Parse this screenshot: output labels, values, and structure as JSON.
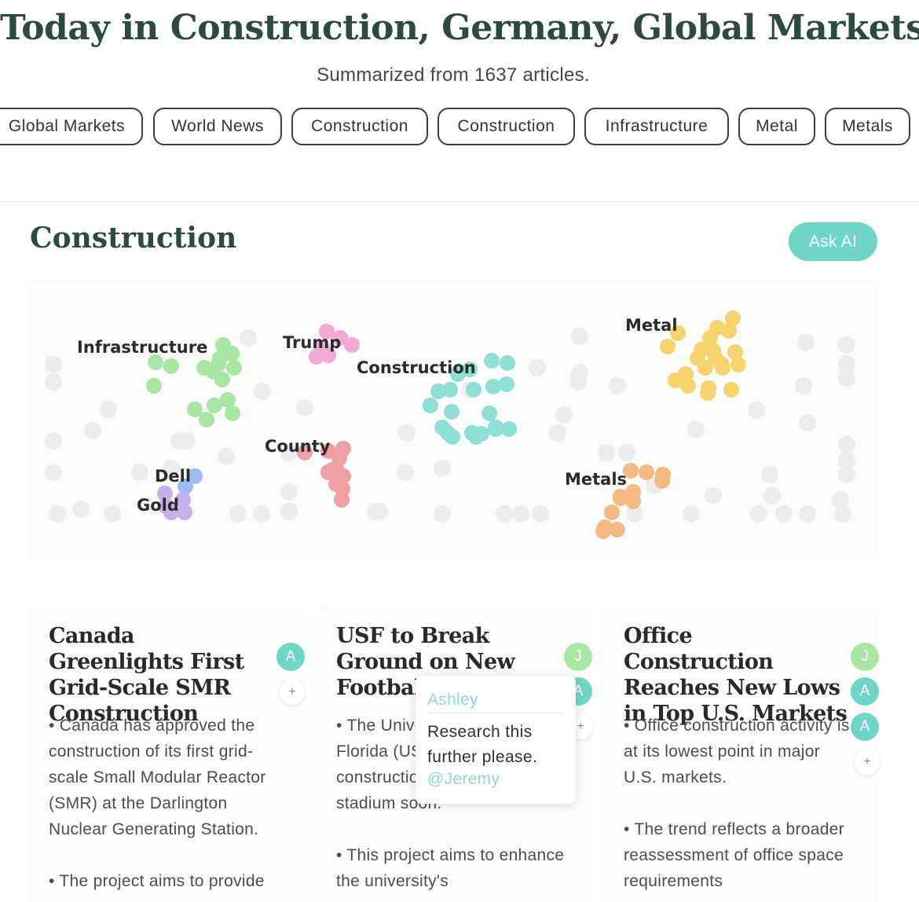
{
  "page": {
    "title": "Today in Construction, Germany, Global Markets",
    "subtitle": "Summarized from 1637 articles."
  },
  "tags": [
    "Global Markets",
    "World News",
    "Construction",
    "Construction",
    "Infrastructure",
    "Metal",
    "Metals"
  ],
  "section": {
    "title": "Construction",
    "ask_ai_label": "Ask AI"
  },
  "cluster_map": {
    "labels": [
      "Infrastructure",
      "Trump",
      "Construction",
      "Metal",
      "County",
      "Dell",
      "Gold",
      "Metals"
    ],
    "colors": {
      "Infrastructure": "#a8e6a3",
      "Trump": "#f2a9d4",
      "Construction": "#8fe0d4",
      "Metal": "#f7d36e",
      "County": "#f0a0a0",
      "Dell": "#9dbdf0",
      "Gold": "#c5b0ec",
      "Metals": "#f5b982",
      "other": "#ececec"
    }
  },
  "cards": [
    {
      "title": "Canada Greenlights First Grid-Scale SMR Construction",
      "bullets": [
        "• Canada has approved the construction of its first grid-scale Small Modular Reactor (SMR) at the Darlington Nuclear Generating Station.",
        "• The project aims to provide"
      ],
      "avatars": [
        "A"
      ],
      "add_label": "+"
    },
    {
      "title": "USF to Break Ground on New Football Stadium",
      "bullets": [
        "• The University of South Florida (USF) will be starting construction on a new football stadium soon.",
        "• This project aims to enhance the university's"
      ],
      "avatars": [
        "J",
        "A"
      ],
      "add_label": "+"
    },
    {
      "title": "Office Construction Reaches New Lows in Top U.S. Markets",
      "bullets": [
        "• Office construction activity is at its lowest point in major U.S. markets.",
        "• The trend reflects a broader reassessment of office space requirements"
      ],
      "avatars": [
        "J",
        "A",
        "A"
      ],
      "add_label": "+"
    }
  ],
  "comment_popup": {
    "author": "Ashley",
    "message": "Research this further please.",
    "mention": "@Jeremy"
  }
}
